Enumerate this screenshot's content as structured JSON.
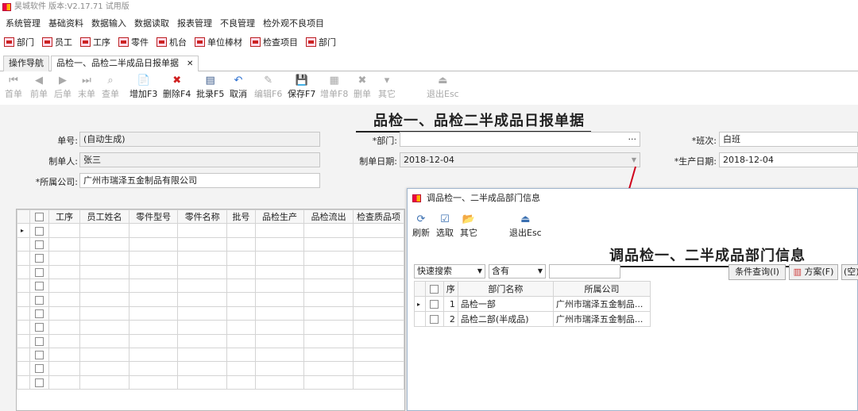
{
  "app": {
    "title": "昊城软件 版本:V2.17.71 试用版",
    "accent_red": "#c8102e"
  },
  "menu": [
    "系统管理",
    "基础资料",
    "数据输入",
    "数据读取",
    "报表管理",
    "不良管理",
    "检外观不良项目"
  ],
  "quickbar": [
    "部门",
    "员工",
    "工序",
    "零件",
    "机台",
    "单位棒材",
    "检查项目",
    "部门"
  ],
  "tabs": [
    {
      "label": "操作导航"
    },
    {
      "label": "品检一、品检二半成品日报单据",
      "close": "✕"
    }
  ],
  "toolbar": [
    {
      "label": "首单",
      "icon": "first-record-icon",
      "glyph": "⏮",
      "disabled": true
    },
    {
      "label": "前单",
      "icon": "prev-record-icon",
      "glyph": "◀",
      "disabled": true
    },
    {
      "label": "后单",
      "icon": "next-record-icon",
      "glyph": "▶",
      "disabled": true
    },
    {
      "label": "末单",
      "icon": "last-record-icon",
      "glyph": "⏭",
      "disabled": true
    },
    {
      "label": "查单",
      "icon": "binoculars-icon",
      "glyph": "⌕",
      "disabled": true
    },
    {
      "label": "增加F3",
      "icon": "add-doc-icon",
      "glyph": "📄",
      "disabled": false
    },
    {
      "label": "删除F4",
      "icon": "delete-icon",
      "glyph": "✖",
      "disabled": false
    },
    {
      "label": "批录F5",
      "icon": "batch-icon",
      "glyph": "▤",
      "disabled": false
    },
    {
      "label": "取消",
      "icon": "undo-icon",
      "glyph": "↶",
      "disabled": false
    },
    {
      "label": "编辑F6",
      "icon": "edit-icon",
      "glyph": "✎",
      "disabled": true
    },
    {
      "label": "保存F7",
      "icon": "save-icon",
      "glyph": "💾",
      "disabled": false
    },
    {
      "label": "增单F8",
      "icon": "add-order-icon",
      "glyph": "▦",
      "disabled": true
    },
    {
      "label": "删单",
      "icon": "delete-order-icon",
      "glyph": "✖",
      "disabled": true
    },
    {
      "label": "其它",
      "icon": "truck-icon",
      "glyph": "▾",
      "disabled": true
    },
    {
      "label": "退出Esc",
      "icon": "exit-icon",
      "glyph": "⏏",
      "disabled": true
    }
  ],
  "form": {
    "title": "品检一、品检二半成品日报单据",
    "doc_no_label": "单号:",
    "doc_no_value": "(自动生成)",
    "creator_label": "制单人:",
    "creator_value": "张三",
    "company_label": "*所属公司:",
    "company_value": "广州市瑞泽五金制品有限公司",
    "dept_label": "*部门:",
    "dept_value": "",
    "dept_ellipsis": "···",
    "date_label": "制单日期:",
    "date_value": "2018-12-04",
    "shift_label": "*班次:",
    "shift_value": "白班",
    "prod_date_label": "*生产日期:",
    "prod_date_value": "2018-12-04"
  },
  "grid": {
    "columns": [
      "工序",
      "员工姓名",
      "零件型号",
      "零件名称",
      "批号",
      "品检生产",
      "品检流出",
      "检查质品项"
    ],
    "empty_rows": 12,
    "current_row_marker": "▸"
  },
  "dialog": {
    "title": "调品检一、二半成品部门信息",
    "heading": "调品检一、二半成品部门信息",
    "buttons": [
      {
        "label": "刷新",
        "icon": "refresh-icon",
        "glyph": "⟳"
      },
      {
        "label": "选取",
        "icon": "select-check-icon",
        "glyph": "☑"
      },
      {
        "label": "其它",
        "icon": "folder-icon",
        "glyph": "📂"
      },
      {
        "label": "退出Esc",
        "icon": "exit-icon",
        "glyph": "⏏"
      }
    ],
    "search_field": "快速搜索",
    "search_op": "含有",
    "search_value": "",
    "query_button": "条件查询(I)",
    "scheme_button": "方案(F)",
    "empty_option": "(空)",
    "columns": [
      "序",
      "部门名称",
      "所属公司"
    ],
    "rows": [
      {
        "seq": "1",
        "name": "品检一部",
        "company": "广州市瑞泽五金制品..."
      },
      {
        "seq": "2",
        "name": "品检二部(半成品)",
        "company": "广州市瑞泽五金制品..."
      }
    ]
  }
}
